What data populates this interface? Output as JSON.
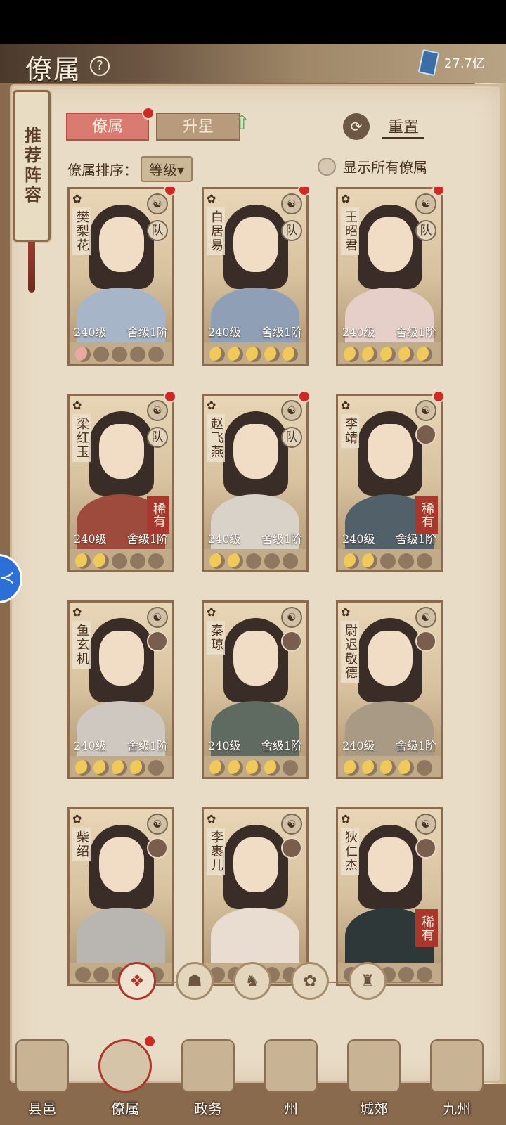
{
  "header": {
    "title": "僚属",
    "help_icon": "?",
    "currency_value": "27.7亿"
  },
  "side_tag": {
    "label": "推荐阵容"
  },
  "tabs": [
    {
      "label": "僚属"
    },
    {
      "label": "升星"
    }
  ],
  "reset": {
    "label": "重置",
    "icon": "⟳"
  },
  "sort": {
    "label": "僚属排序：",
    "value": "等级▾"
  },
  "show_all": {
    "label": "显示所有僚属"
  },
  "cards": [
    {
      "name": "樊梨花",
      "level": "240级",
      "house": "舍级1阶",
      "role": "队",
      "lit": 1,
      "style": "red",
      "rare": ""
    },
    {
      "name": "白居易",
      "level": "240级",
      "house": "舍级1阶",
      "role": "队",
      "lit": 5,
      "style": "gold",
      "rare": ""
    },
    {
      "name": "王昭君",
      "level": "240级",
      "house": "舍级1阶",
      "role": "队",
      "lit": 5,
      "style": "gold",
      "rare": ""
    },
    {
      "name": "梁红玉",
      "level": "240级",
      "house": "舍级1阶",
      "role": "队",
      "lit": 2,
      "style": "gold",
      "rare": "稀有"
    },
    {
      "name": "赵飞燕",
      "level": "240级",
      "house": "舍级1阶",
      "role": "队",
      "lit": 2,
      "style": "gold",
      "rare": ""
    },
    {
      "name": "李靖",
      "level": "240级",
      "house": "舍级1阶",
      "role": "",
      "lit": 2,
      "style": "gold",
      "rare": "稀有"
    },
    {
      "name": "鱼玄机",
      "level": "240级",
      "house": "舍级1阶",
      "role": "",
      "lit": 4,
      "style": "gold",
      "rare": ""
    },
    {
      "name": "秦琼",
      "level": "240级",
      "house": "舍级1阶",
      "role": "",
      "lit": 4,
      "style": "gold",
      "rare": ""
    },
    {
      "name": "尉迟敬德",
      "level": "240级",
      "house": "舍级1阶",
      "role": "",
      "lit": 4,
      "style": "gold",
      "rare": ""
    },
    {
      "name": "柴绍",
      "level": "",
      "house": "",
      "role": "",
      "lit": 0,
      "style": "gold",
      "rare": ""
    },
    {
      "name": "李裹儿",
      "level": "",
      "house": "",
      "role": "",
      "lit": 0,
      "style": "gold",
      "rare": ""
    },
    {
      "name": "狄仁杰",
      "level": "",
      "house": "",
      "role": "",
      "lit": 0,
      "style": "gold",
      "rare": "稀有"
    }
  ],
  "filters": [
    {
      "icon": "❖"
    },
    {
      "icon": "☗"
    },
    {
      "icon": "♞"
    },
    {
      "icon": "✿"
    },
    {
      "icon": "♜"
    }
  ],
  "nav": [
    {
      "label": "县邑"
    },
    {
      "label": "僚属"
    },
    {
      "label": "政务"
    },
    {
      "label": "州"
    },
    {
      "label": "城郊"
    },
    {
      "label": "九州"
    }
  ],
  "side_float": {
    "icon": "≺"
  }
}
